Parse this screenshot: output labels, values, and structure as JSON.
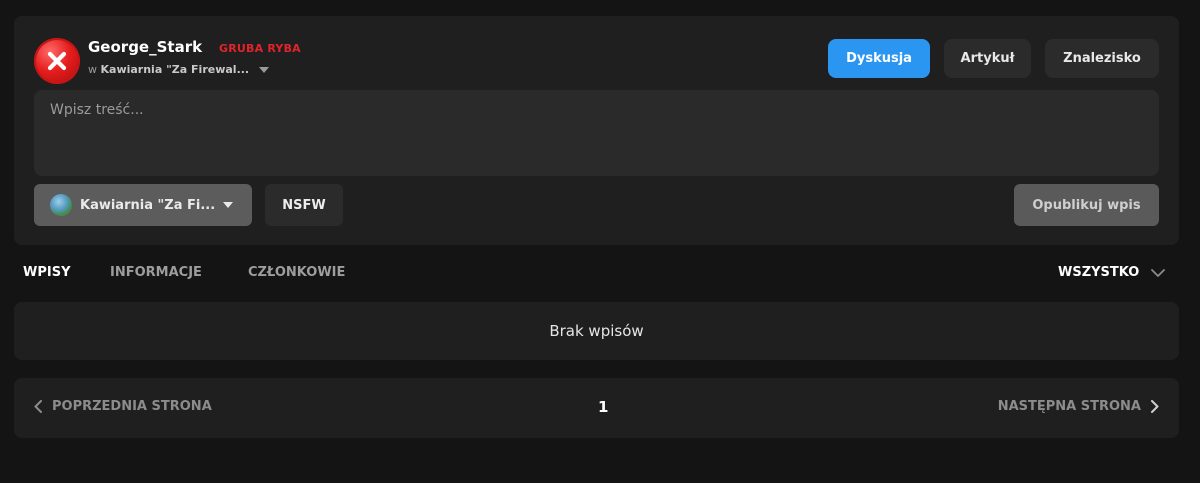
{
  "composer": {
    "author": {
      "username": "George_Stark",
      "rank": "GRUBA RYBA",
      "location_prefix": "w",
      "location_name": "Kawiarnia \"Za Firewal...",
      "avatar_icon": "red-x-error-icon"
    },
    "post_types": [
      {
        "label": "Dyskusja",
        "active": true
      },
      {
        "label": "Artykuł",
        "active": false
      },
      {
        "label": "Znalezisko",
        "active": false
      }
    ],
    "content_placeholder": "Wpisz treść...",
    "channel_select": {
      "label": "Kawiarnia \"Za Fi...",
      "icon": "channel-globe-icon"
    },
    "nsfw_label": "NSFW",
    "publish_label": "Opublikuj wpis"
  },
  "tabs": [
    {
      "label": "WPISY",
      "active": true
    },
    {
      "label": "INFORMACJE",
      "active": false
    },
    {
      "label": "CZŁONKOWIE",
      "active": false
    }
  ],
  "filter": {
    "label": "WSZYSTKO",
    "icon": "chevron-down-icon"
  },
  "feed": {
    "empty_message": "Brak wpisów"
  },
  "pagination": {
    "prev_label": "POPRZEDNIA STRONA",
    "current_page": "1",
    "next_label": "NASTĘPNA STRONA"
  },
  "colors": {
    "background": "#141414",
    "panel": "#1f1f1f",
    "accent": "#2b96f1",
    "rank": "#e0242a"
  }
}
